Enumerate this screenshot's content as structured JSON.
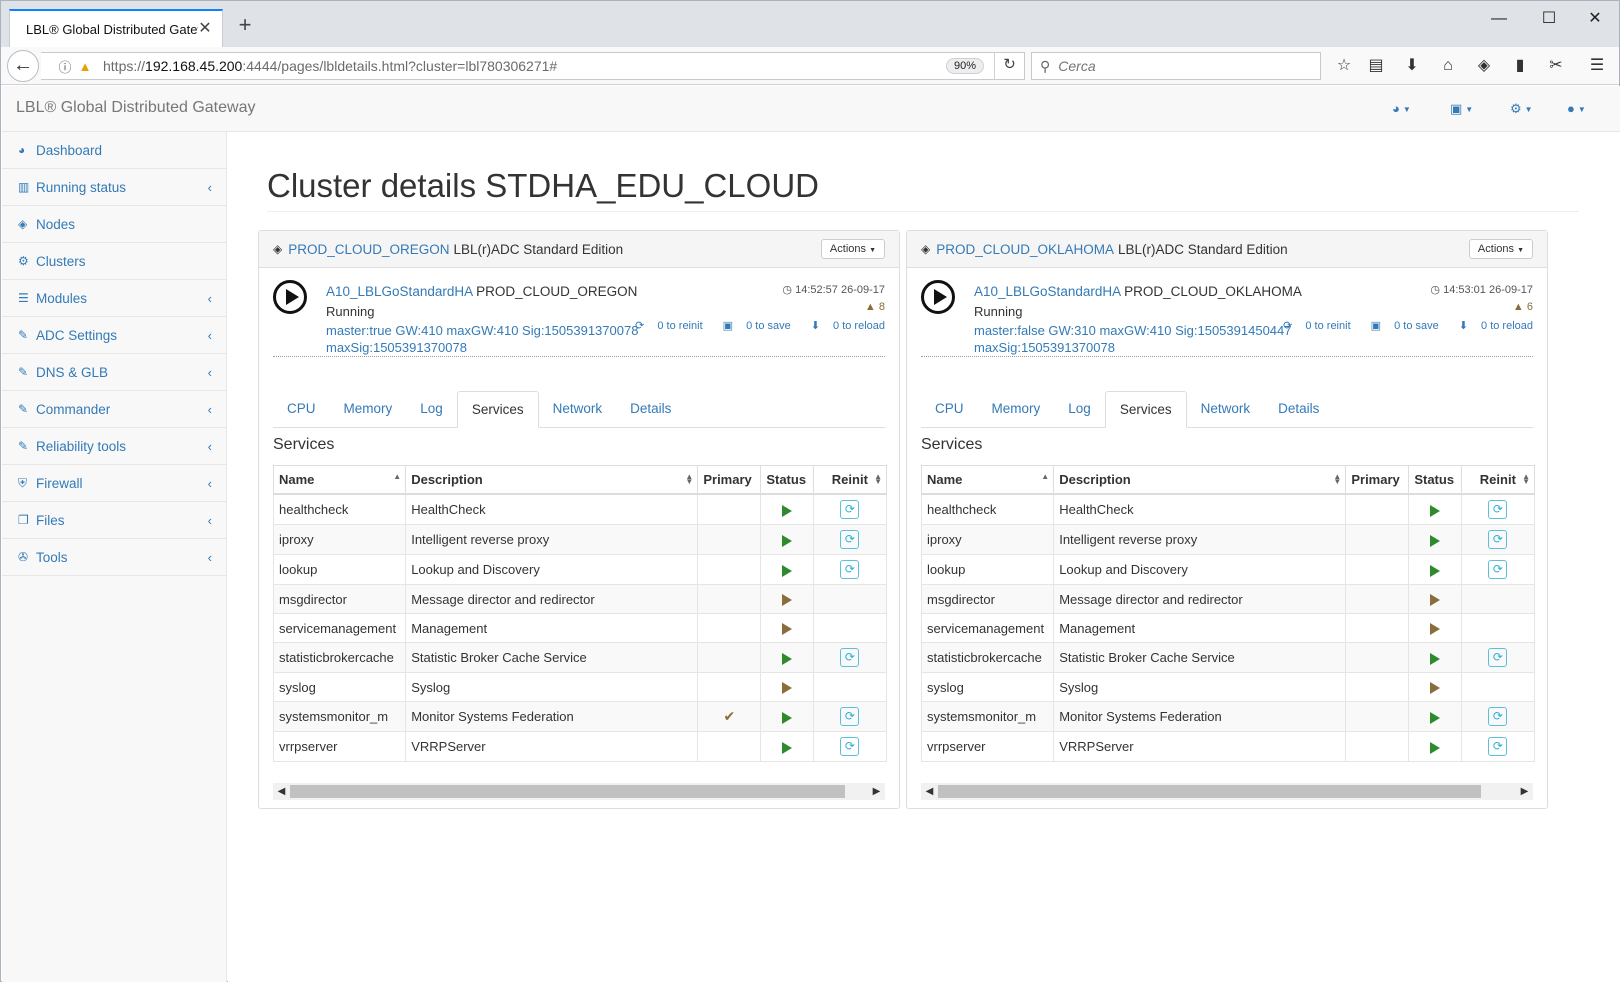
{
  "browser": {
    "tab_title": "LBL® Global Distributed Gateway",
    "url_prefix": "https://",
    "url_host": "192.168.45.200",
    "url_rest": ":4444/pages/lbldetails.html?cluster=lbl780306271#",
    "zoom": "90%",
    "search_placeholder": "Cerca"
  },
  "header": {
    "brand": "LBL® Global Distributed Gateway"
  },
  "sidebar": {
    "items": [
      {
        "label": "Dashboard",
        "icon": "dashboard-icon",
        "chevron": false
      },
      {
        "label": "Running status",
        "icon": "bar-chart-icon",
        "chevron": true
      },
      {
        "label": "Nodes",
        "icon": "cube-icon",
        "chevron": false
      },
      {
        "label": "Clusters",
        "icon": "cogs-icon",
        "chevron": false
      },
      {
        "label": "Modules",
        "icon": "list-icon",
        "chevron": true
      },
      {
        "label": "ADC Settings",
        "icon": "edit-icon",
        "chevron": true
      },
      {
        "label": "DNS & GLB",
        "icon": "edit-icon",
        "chevron": true
      },
      {
        "label": "Commander",
        "icon": "edit-icon",
        "chevron": true
      },
      {
        "label": "Reliability tools",
        "icon": "edit-icon",
        "chevron": true
      },
      {
        "label": "Firewall",
        "icon": "shield-icon",
        "chevron": true
      },
      {
        "label": "Files",
        "icon": "files-icon",
        "chevron": true
      },
      {
        "label": "Tools",
        "icon": "wrench-icon",
        "chevron": true
      }
    ]
  },
  "main": {
    "title": "Cluster details STDHA_EDU_CLOUD",
    "tabs": [
      "CPU",
      "Memory",
      "Log",
      "Services",
      "Network",
      "Details"
    ],
    "active_tab": "Services",
    "services_title": "Services",
    "columns": {
      "name": "Name",
      "description": "Description",
      "primary": "Primary",
      "status": "Status",
      "reinit": "Reinit"
    },
    "actions_label": "Actions"
  },
  "panels": [
    {
      "cluster_link": "PROD_CLOUD_OREGON",
      "edition": "LBL(r)ADC Standard Edition",
      "node_link": "A10_LBLGoStandardHA",
      "node_name": "PROD_CLOUD_OREGON",
      "state": "Running",
      "info_line1": "master:true GW:410 maxGW:410 Sig:1505391370078",
      "info_line2": "maxSig:1505391370078",
      "time": "14:52:57 26-09-17",
      "alerts": "8",
      "reinit": "0 to reinit",
      "save": "0 to save",
      "reload": "0 to reload",
      "services": [
        {
          "name": "healthcheck",
          "desc": "HealthCheck",
          "primary": false,
          "status": "green",
          "reinit": true
        },
        {
          "name": "iproxy",
          "desc": "Intelligent reverse proxy",
          "primary": false,
          "status": "green",
          "reinit": true
        },
        {
          "name": "lookup",
          "desc": "Lookup and Discovery",
          "primary": false,
          "status": "green",
          "reinit": true
        },
        {
          "name": "msgdirector",
          "desc": "Message director and redirector",
          "primary": false,
          "status": "brown",
          "reinit": false
        },
        {
          "name": "servicemanagement",
          "desc": "Management",
          "primary": false,
          "status": "brown",
          "reinit": false
        },
        {
          "name": "statisticbrokercache",
          "desc": "Statistic Broker Cache Service",
          "primary": false,
          "status": "green",
          "reinit": true
        },
        {
          "name": "syslog",
          "desc": "Syslog",
          "primary": false,
          "status": "brown",
          "reinit": false
        },
        {
          "name": "systemsmonitor_m",
          "desc": "Monitor Systems Federation",
          "primary": true,
          "status": "green",
          "reinit": true
        },
        {
          "name": "vrrpserver",
          "desc": "VRRPServer",
          "primary": false,
          "status": "green",
          "reinit": true
        }
      ]
    },
    {
      "cluster_link": "PROD_CLOUD_OKLAHOMA",
      "edition": "LBL(r)ADC Standard Edition",
      "node_link": "A10_LBLGoStandardHA",
      "node_name": "PROD_CLOUD_OKLAHOMA",
      "state": "Running",
      "info_line1": "master:false GW:310 maxGW:410 Sig:1505391450447",
      "info_line2": "maxSig:1505391370078",
      "time": "14:53:01 26-09-17",
      "alerts": "6",
      "reinit": "0 to reinit",
      "save": "0 to save",
      "reload": "0 to reload",
      "services": [
        {
          "name": "healthcheck",
          "desc": "HealthCheck",
          "primary": false,
          "status": "green",
          "reinit": true
        },
        {
          "name": "iproxy",
          "desc": "Intelligent reverse proxy",
          "primary": false,
          "status": "green",
          "reinit": true
        },
        {
          "name": "lookup",
          "desc": "Lookup and Discovery",
          "primary": false,
          "status": "green",
          "reinit": true
        },
        {
          "name": "msgdirector",
          "desc": "Message director and redirector",
          "primary": false,
          "status": "brown",
          "reinit": false
        },
        {
          "name": "servicemanagement",
          "desc": "Management",
          "primary": false,
          "status": "brown",
          "reinit": false
        },
        {
          "name": "statisticbrokercache",
          "desc": "Statistic Broker Cache Service",
          "primary": false,
          "status": "green",
          "reinit": true
        },
        {
          "name": "syslog",
          "desc": "Syslog",
          "primary": false,
          "status": "brown",
          "reinit": false
        },
        {
          "name": "systemsmonitor_m",
          "desc": "Monitor Systems Federation",
          "primary": false,
          "status": "green",
          "reinit": true
        },
        {
          "name": "vrrpserver",
          "desc": "VRRPServer",
          "primary": false,
          "status": "green",
          "reinit": true
        }
      ]
    }
  ],
  "colors": {
    "link": "#337ab7",
    "running": "#2d8a2d",
    "stopped": "#8a6d3b",
    "reinit": "#5bc0de"
  }
}
